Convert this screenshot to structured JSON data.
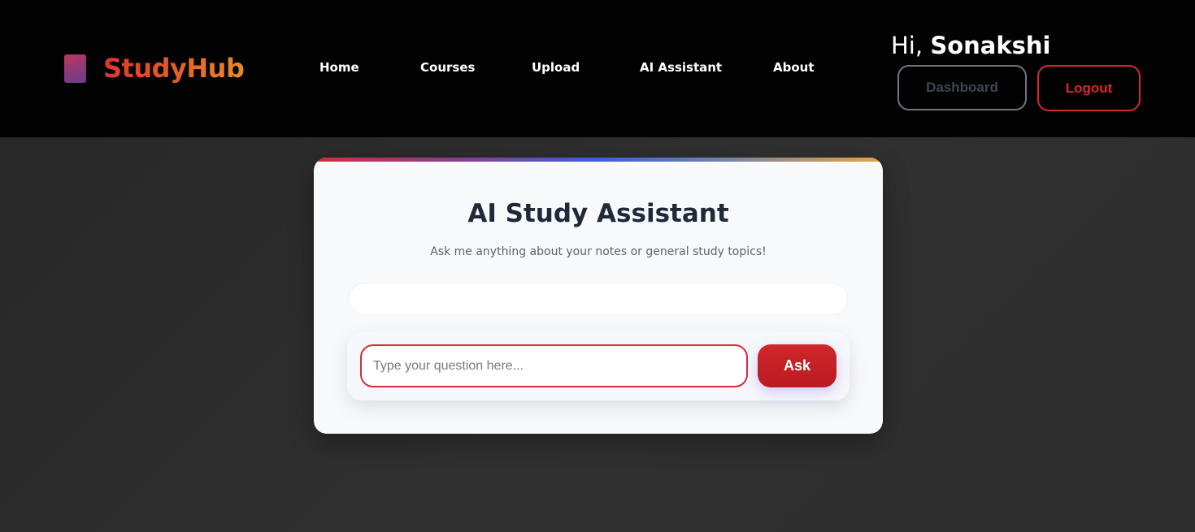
{
  "header": {
    "brand": "StudyHub",
    "nav": [
      {
        "label": "Home"
      },
      {
        "label": "Courses"
      },
      {
        "label": "Upload"
      },
      {
        "label": "AI Assistant"
      },
      {
        "label": "About"
      }
    ],
    "greeting_prefix": "Hi,",
    "user_name": "Sonakshi",
    "dashboard_label": "Dashboard",
    "logout_label": "Logout"
  },
  "assistant": {
    "title": "AI Study Assistant",
    "subtitle": "Ask me anything about your notes or general study topics!",
    "input_placeholder": "Type your question here...",
    "input_value": "",
    "ask_label": "Ask"
  },
  "colors": {
    "accent": "#d0262b",
    "brand_gradient_start": "#e0352b",
    "brand_gradient_end": "#ee8a26",
    "header_bg": "#020202"
  },
  "icons": {
    "logo": "book-icon"
  }
}
